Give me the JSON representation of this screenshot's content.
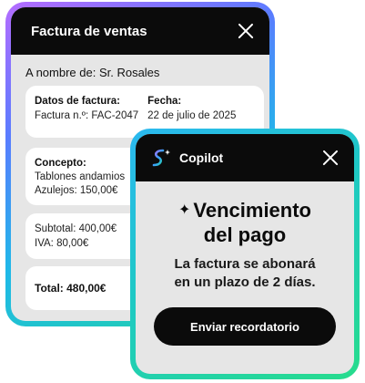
{
  "invoice_window": {
    "title": "Factura de ventas",
    "recipient": "A nombre de: Sr. Rosales",
    "details_card": {
      "data_label": "Datos de factura:",
      "number": "Factura n.º: FAC-2047",
      "date_label": "Fecha:",
      "date": "22 de julio de 2025"
    },
    "concept_card": {
      "label": "Concepto:",
      "line1": "Tablones andamios",
      "line2": "Azulejos: 150,00€"
    },
    "totals_card": {
      "subtotal": "Subtotal: 400,00€",
      "iva": "IVA: 80,00€"
    },
    "total": "Total: 480,00€"
  },
  "copilot_window": {
    "title": "Copilot",
    "heading_line1": "Vencimiento",
    "heading_line2": "del pago",
    "description_line1": "La factura se abonará",
    "description_line2": "en un plazo de 2 días.",
    "button_label": "Enviar recordatorio"
  },
  "icons": {
    "close": "close-icon",
    "copilot": "copilot-logo-icon",
    "sparkle": "sparkle-icon"
  },
  "colors": {
    "titlebar": "#0b0b0b",
    "window_bg": "#e6e6e6",
    "card_bg": "#ffffff",
    "gradient_start": "#b56cff",
    "gradient_end": "#22d4a4"
  }
}
